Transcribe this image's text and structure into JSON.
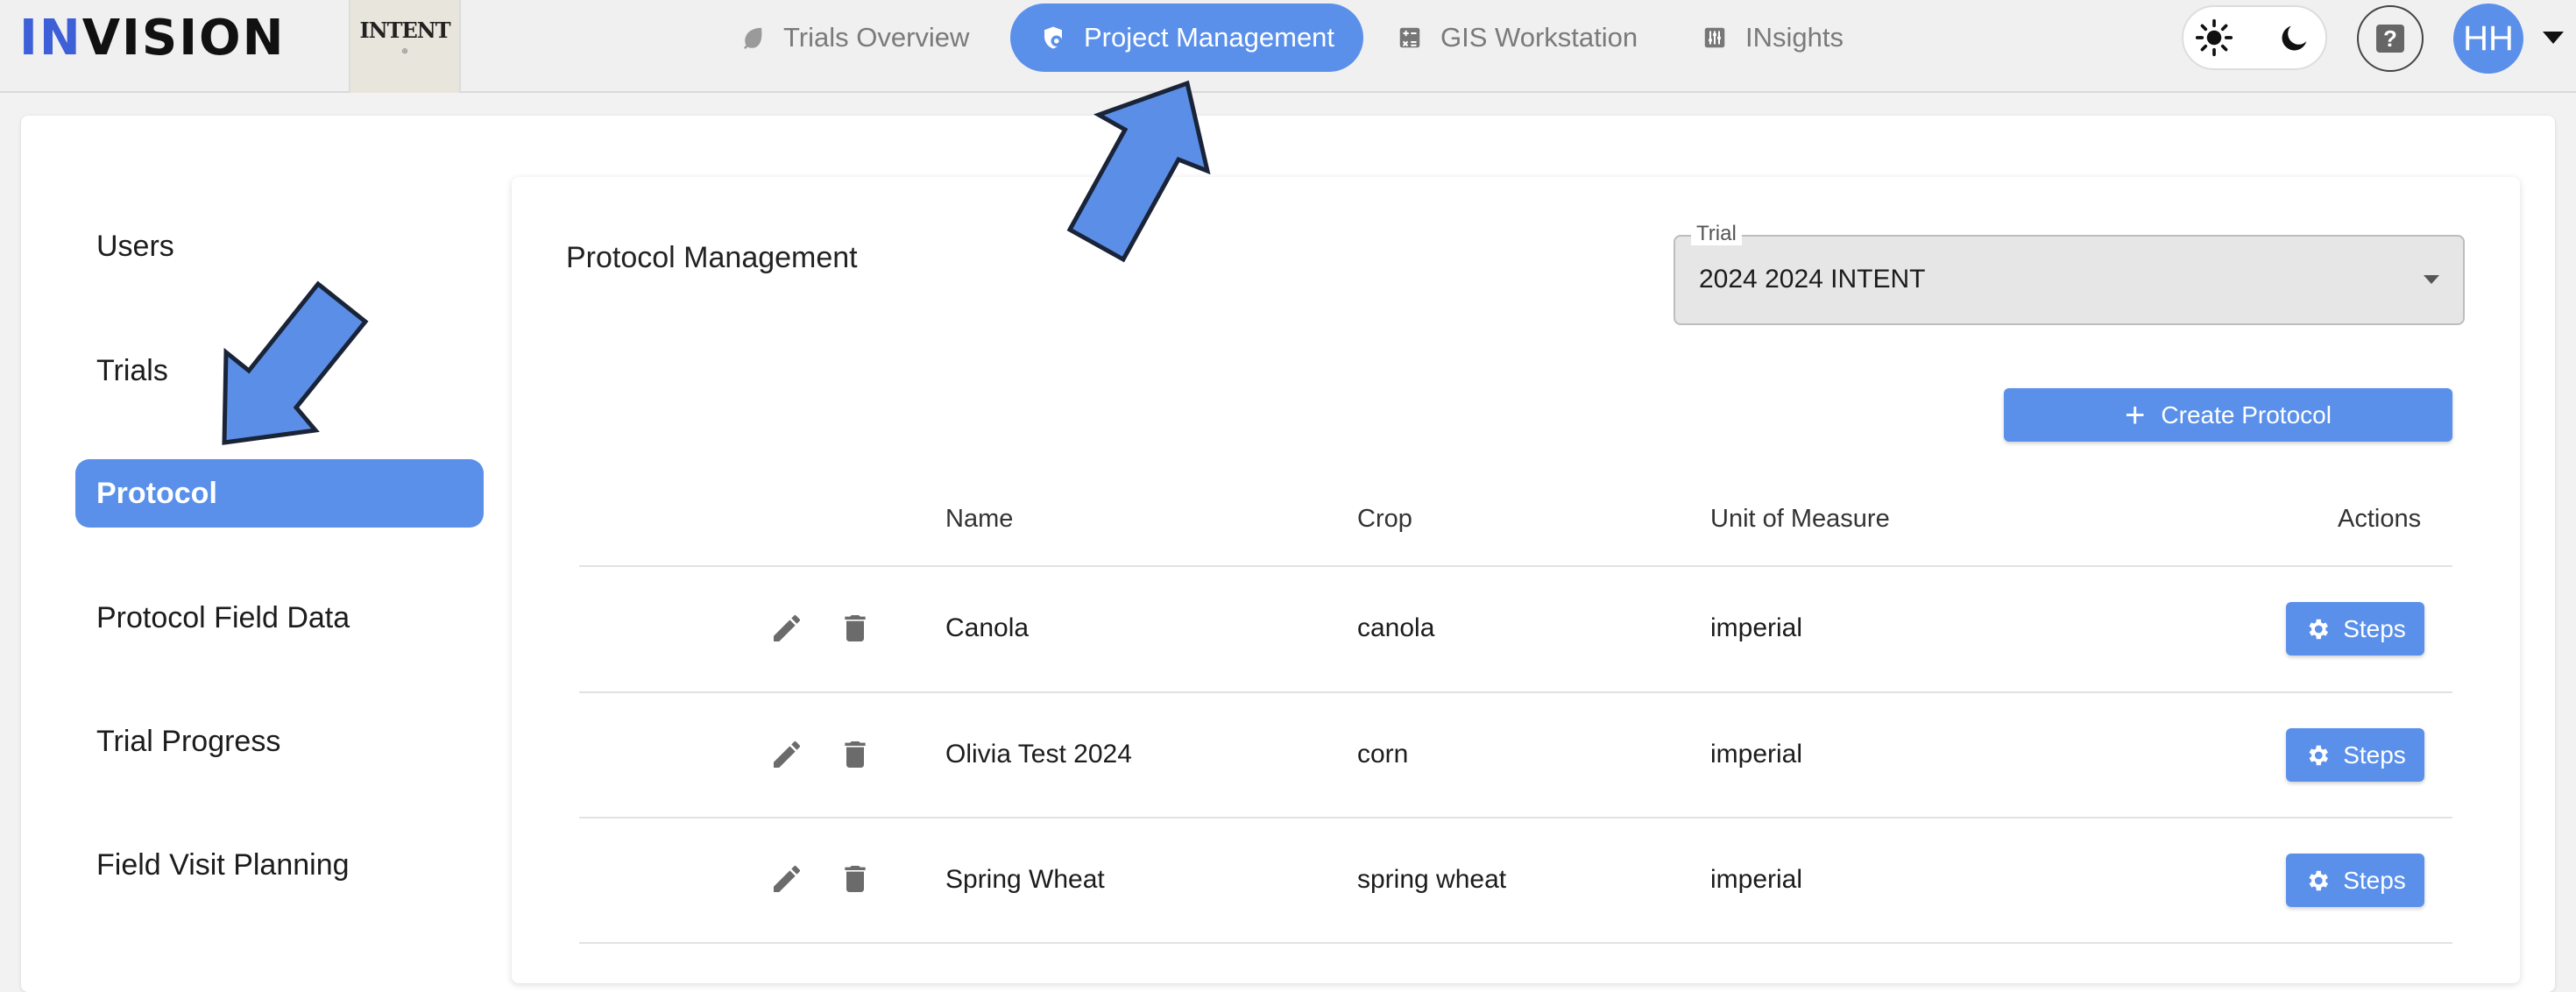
{
  "header": {
    "logo": {
      "prefix": "IN",
      "rest": "VISION"
    },
    "client_logo": {
      "text": "INTENT"
    },
    "nav": [
      {
        "label": "Trials Overview",
        "icon": "leaf-icon",
        "active": false
      },
      {
        "label": "Project Management",
        "icon": "shield-gear-icon",
        "active": true
      },
      {
        "label": "GIS Workstation",
        "icon": "calculator-icon",
        "active": false
      },
      {
        "label": "INsights",
        "icon": "sliders-icon",
        "active": false
      }
    ],
    "theme_toggle": {
      "light_icon": "sun-icon",
      "dark_icon": "moon-icon",
      "selected": "light"
    },
    "help_icon": "question-icon",
    "avatar_initials": "HH"
  },
  "sidebar": {
    "items": [
      {
        "label": "Users",
        "active": false
      },
      {
        "label": "Trials",
        "active": false
      },
      {
        "label": "Protocol",
        "active": true
      },
      {
        "label": "Protocol Field Data",
        "active": false
      },
      {
        "label": "Trial Progress",
        "active": false
      },
      {
        "label": "Field Visit Planning",
        "active": false
      }
    ]
  },
  "main": {
    "title": "Protocol Management",
    "trial_select": {
      "label": "Trial",
      "value": "2024 2024 INTENT"
    },
    "create_button": "Create Protocol",
    "table": {
      "columns": [
        "Name",
        "Crop",
        "Unit of Measure",
        "Actions"
      ],
      "rows": [
        {
          "name": "Canola",
          "crop": "canola",
          "unit": "imperial",
          "action": "Steps"
        },
        {
          "name": "Olivia Test 2024",
          "crop": "corn",
          "unit": "imperial",
          "action": "Steps"
        },
        {
          "name": "Spring Wheat",
          "crop": "spring wheat",
          "unit": "imperial",
          "action": "Steps"
        }
      ]
    }
  },
  "colors": {
    "accent": "#5a90ea",
    "annotation_arrow_fill": "#5b8ee6",
    "annotation_arrow_stroke": "#1a2438",
    "logo_accent": "#3d5fd8"
  }
}
